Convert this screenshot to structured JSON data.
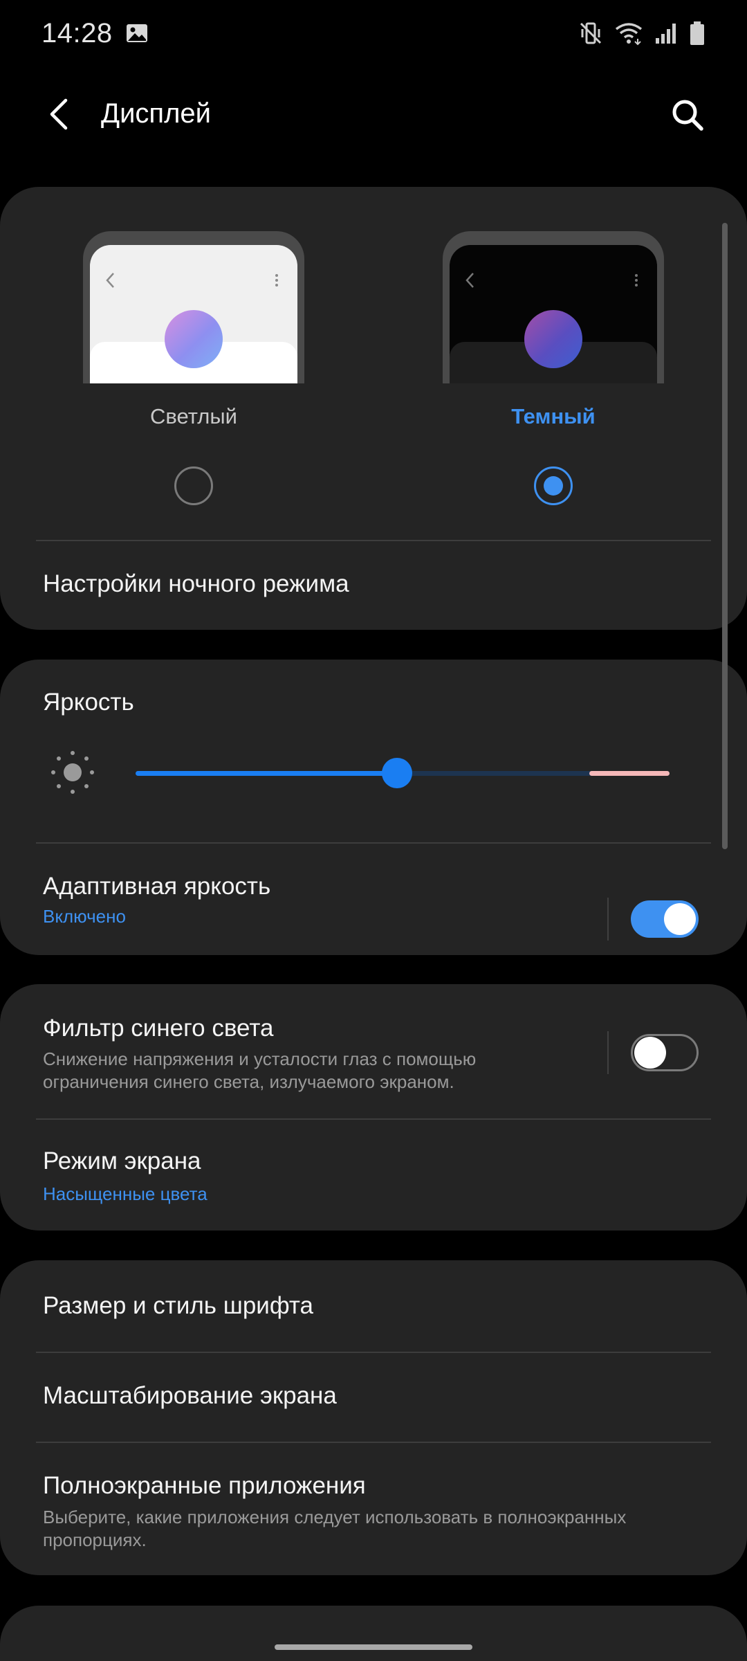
{
  "status_bar": {
    "time": "14:28",
    "icons": [
      "gallery-icon",
      "mute-icon",
      "wifi-icon",
      "signal-icon",
      "battery-icon"
    ]
  },
  "app_bar": {
    "title": "Дисплей",
    "icons": [
      "back-arrow-icon",
      "search-icon"
    ]
  },
  "theme": {
    "light_label": "Светлый",
    "dark_label": "Темный",
    "selected": "dark",
    "night_mode_settings": "Настройки ночного режима"
  },
  "brightness": {
    "title": "Яркость",
    "level": 0.49,
    "adaptive_title": "Адаптивная яркость",
    "adaptive_status": "Включено",
    "adaptive_on": true
  },
  "blue_light": {
    "title": "Фильтр синего света",
    "description_line1": "Снижение напряжения и усталости глаз с помощью",
    "description_line2": "ограничения синего света, излучаемого экраном.",
    "enabled": false
  },
  "screen_mode": {
    "title": "Режим экрана",
    "value": "Насыщенные цвета"
  },
  "font": {
    "title": "Размер и стиль шрифта"
  },
  "zoom": {
    "title": "Масштабирование экрана"
  },
  "fullscreen_apps": {
    "title": "Полноэкранные приложения",
    "description_line1": "Выберите, какие приложения следует использовать в полноэкранных",
    "description_line2": "пропорциях."
  },
  "colors": {
    "accent": "#3e91f1",
    "card": "#242424",
    "background": "#000000",
    "toggle_on": "#3e91f1",
    "slider_active": "#1a7ef2",
    "slider_end": "#f5b8b8"
  }
}
